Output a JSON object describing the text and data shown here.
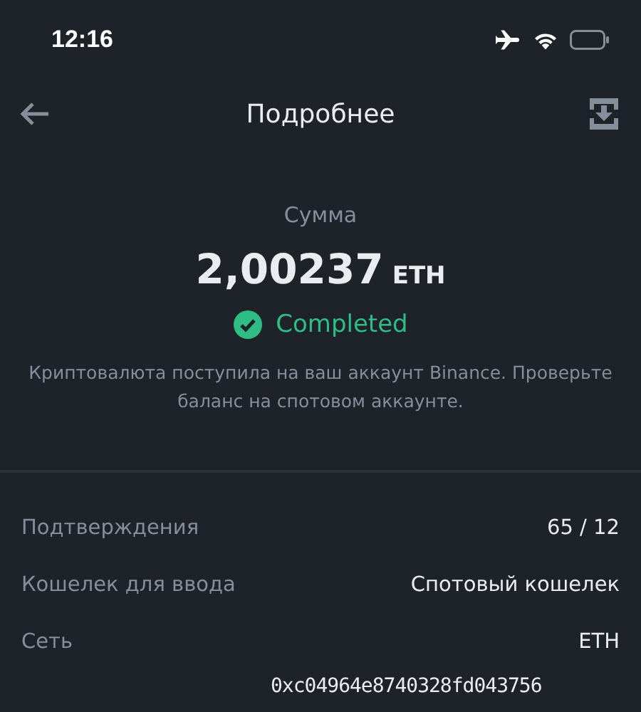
{
  "status_bar": {
    "time": "12:16"
  },
  "header": {
    "title": "Подробнее"
  },
  "summary": {
    "label": "Сумма",
    "amount": "2,00237",
    "currency": "ETH",
    "status": {
      "kind": "completed",
      "text": "Completed"
    },
    "message": "Криптовалюта поступила на ваш аккаунт Binance. Проверьте баланс на спотовом аккаунте."
  },
  "details": [
    {
      "label": "Подтверждения",
      "value": "65 / 12"
    },
    {
      "label": "Кошелек для ввода",
      "value": "Спотовый кошелек"
    },
    {
      "label": "Сеть",
      "value": "ETH"
    }
  ],
  "address_fragment": "0xc04964e8740328fd043756"
}
